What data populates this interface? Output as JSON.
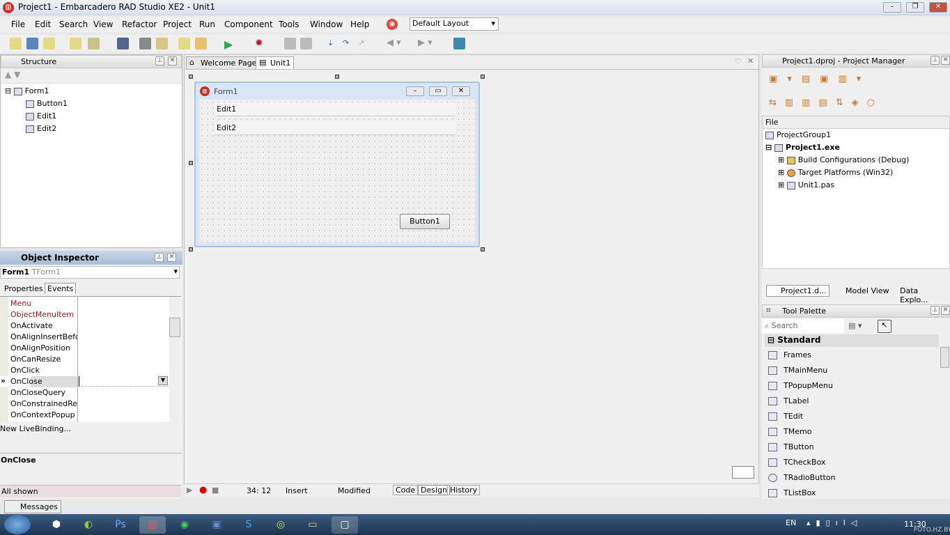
{
  "title": "Project1 - Embarcadero RAD Studio XE2 - Unit1",
  "menu": [
    "File",
    "Edit",
    "Search",
    "View",
    "Refactor",
    "Project",
    "Run",
    "Component",
    "Tools",
    "Window",
    "Help"
  ],
  "layout": "Default Layout",
  "structure": {
    "title": "Structure",
    "root": "Form1",
    "children": [
      "Button1",
      "Edit1",
      "Edit2"
    ]
  },
  "tabs": [
    "Welcome Page",
    "Unit1"
  ],
  "form": {
    "caption": "Form1",
    "edit1": "Edit1",
    "edit2": "Edit2",
    "button": "Button1"
  },
  "inspector": {
    "title": "Object Inspector",
    "object": "Form1",
    "type": "TForm1",
    "tabs": [
      "Properties",
      "Events"
    ],
    "events": [
      "Menu",
      "ObjectMenuItem",
      "OnActivate",
      "OnAlignInsertBefore",
      "OnAlignPosition",
      "OnCanResize",
      "OnClick",
      "OnClose",
      "OnCloseQuery",
      "OnConstrainedResize",
      "OnContextPopup"
    ],
    "selected_marker": "»",
    "livebinding": "New LiveBinding...",
    "desc": "OnClose",
    "footer": "All shown"
  },
  "status": {
    "pos": "34: 12",
    "mode": "Insert",
    "state": "Modified",
    "views": [
      "Code",
      "Design",
      "History"
    ]
  },
  "project": {
    "title": "Project1.dproj - Project Manager",
    "file_label": "File",
    "group": "ProjectGroup1",
    "exe": "Project1.exe",
    "items": [
      "Build Configurations (Debug)",
      "Target Platforms (Win32)",
      "Unit1.pas"
    ],
    "tabs": [
      "Project1.d...",
      "Model View",
      "Data Explo..."
    ]
  },
  "palette": {
    "title": "Tool Palette",
    "search_placeholder": "Search",
    "category": "Standard",
    "items": [
      "Frames",
      "TMainMenu",
      "TPopupMenu",
      "TLabel",
      "TEdit",
      "TMemo",
      "TButton",
      "TCheckBox",
      "TRadioButton",
      "TListBox"
    ]
  },
  "messages": "Messages",
  "tray": {
    "lang": "EN",
    "time": "11:30",
    "watermark": "FOTO.HZ.BY"
  }
}
